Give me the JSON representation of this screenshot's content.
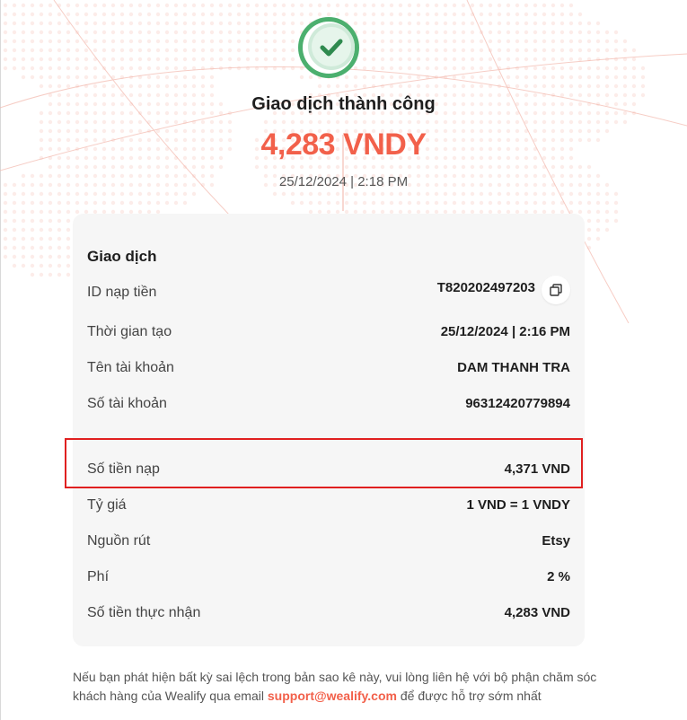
{
  "header": {
    "status_title": "Giao dịch thành công",
    "amount": "4,283 VNDY",
    "datetime": "25/12/2024 | 2:18 PM"
  },
  "colors": {
    "accent": "#f2604a",
    "success_green": "#4caf6e",
    "highlight_red": "#e02020",
    "card_bg": "#f6f6f6"
  },
  "icons": {
    "status": "check-circle-icon",
    "copy": "copy-icon"
  },
  "transaction": {
    "section_title": "Giao dịch",
    "rows": [
      {
        "label": "ID nạp tiền",
        "value": "T820202497203"
      },
      {
        "label": "Thời gian tạo",
        "value": "25/12/2024 | 2:16 PM"
      },
      {
        "label": "Tên tài khoản",
        "value": "DAM THANH TRA"
      },
      {
        "label": "Số tài khoản",
        "value": "96312420779894"
      },
      {
        "label": "Số tiền nạp",
        "value": "4,371 VND"
      },
      {
        "label": "Tỷ giá",
        "value": "1 VND = 1 VNDY"
      },
      {
        "label": "Nguồn rút",
        "value": "Etsy"
      },
      {
        "label": "Phí",
        "value": "2 %"
      },
      {
        "label": "Số tiền thực nhận",
        "value": "4,283 VND"
      }
    ]
  },
  "footer": {
    "text_before": "Nếu bạn phát hiện bất kỳ sai lệch trong bản sao kê này, vui lòng liên hệ với bộ phận chăm sóc khách hàng của Wealify qua email ",
    "email": "support@wealify.com",
    "text_after": " để được hỗ trợ sớm nhất"
  }
}
